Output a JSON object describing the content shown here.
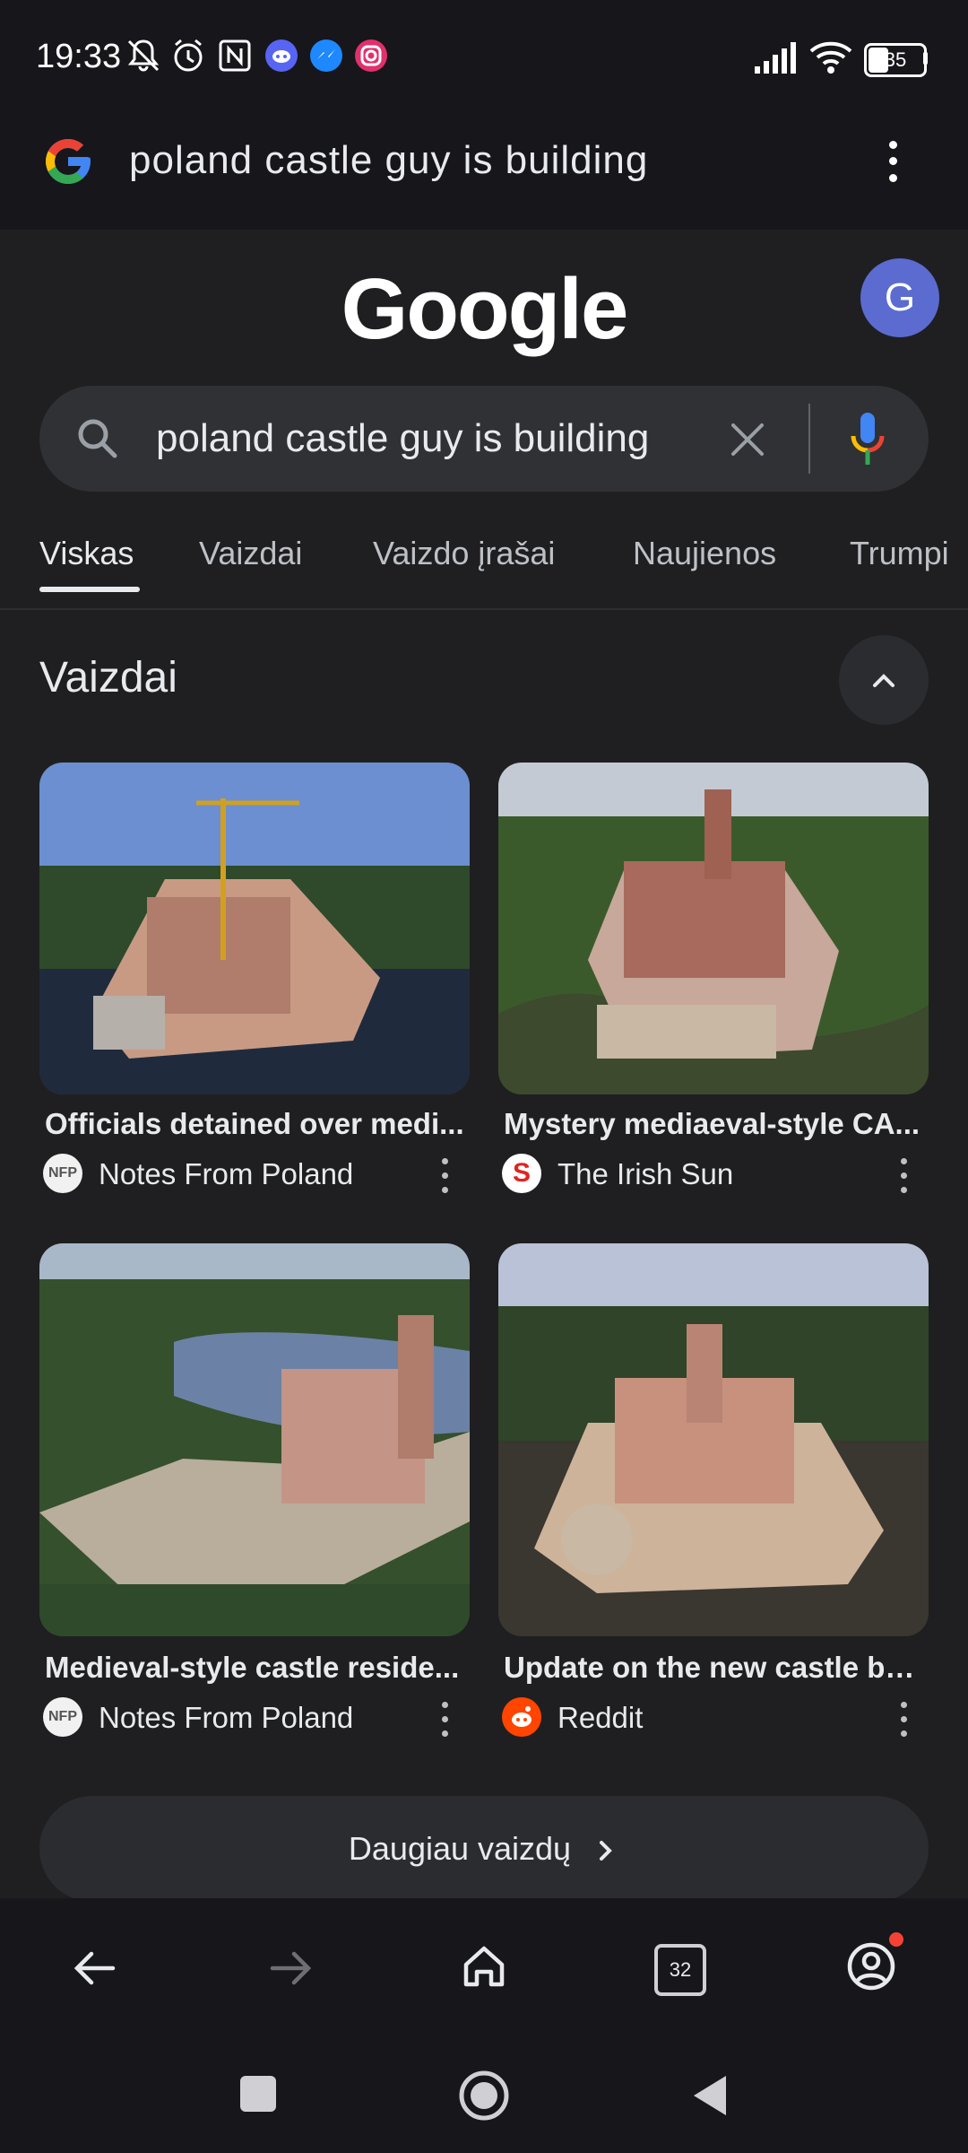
{
  "status": {
    "time": "19:33",
    "battery": "35"
  },
  "urlbar": {
    "query": "poland castle guy is building"
  },
  "google": {
    "logo": "Google",
    "avatar_letter": "G"
  },
  "search": {
    "value": "poland castle guy is building"
  },
  "tabs": [
    {
      "label": "Viskas",
      "active": true
    },
    {
      "label": "Vaizdai"
    },
    {
      "label": "Vaizdo įrašai"
    },
    {
      "label": "Naujienos"
    },
    {
      "label": "Trumpi"
    }
  ],
  "images_section": {
    "title": "Vaizdai",
    "cards": [
      {
        "title": "Officials detained over medi...",
        "source": "Notes From Poland",
        "source_icon": "NFP"
      },
      {
        "title": "Mystery mediaeval-style CA...",
        "source": "The Irish Sun",
        "source_icon": "S"
      },
      {
        "title": "Medieval-style castle reside...",
        "source": "Notes From Poland",
        "source_icon": "NFP"
      },
      {
        "title": "Update on the new castle bei...",
        "source": "Reddit",
        "source_icon": "reddit-icon"
      }
    ],
    "more_label": "Daugiau vaizdų"
  },
  "toolbar": {
    "tab_count": "32"
  },
  "colors": {
    "accent": "#8ab4f8",
    "avatar": "#5b6bd0",
    "background": "#1f1f21"
  }
}
